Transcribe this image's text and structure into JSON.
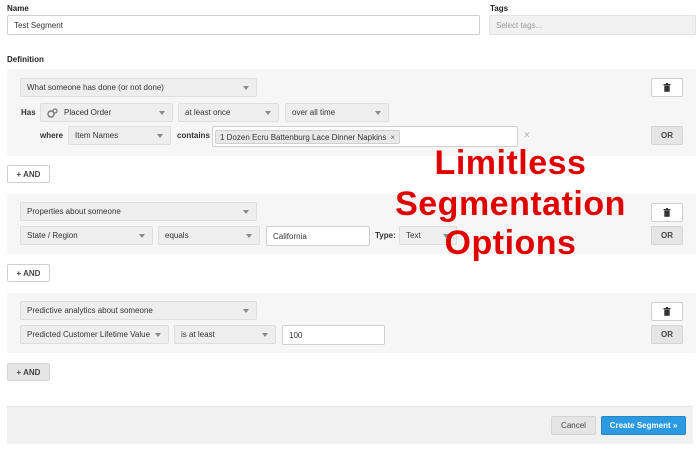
{
  "form": {
    "name_label": "Name",
    "name_value": "Test Segment",
    "tags_label": "Tags",
    "tags_placeholder": "Select tags...",
    "definition_label": "Definition"
  },
  "condition1": {
    "type_select": "What someone has done (or not done)",
    "has_label": "Has",
    "event_select": "Placed Order",
    "frequency_select": "at least once",
    "time_select": "over all time",
    "where_label": "where",
    "property_select": "Item Names",
    "contains_label": "contains",
    "tag_value": "1 Dozen Ecru Battenburg Lace Dinner Napkins",
    "tag_remove": "×",
    "clear_mark": "×",
    "or_button": "OR"
  },
  "and_buttons": [
    "+ AND",
    "+ AND",
    "+ AND"
  ],
  "condition2": {
    "type_select": "Properties about someone",
    "property_select": "State / Region",
    "operator_select": "equals",
    "value": "California",
    "type_label": "Type:",
    "datatype_select": "Text",
    "or_button": "OR"
  },
  "condition3": {
    "type_select": "Predictive analytics about someone",
    "property_select": "Predicted Customer Lifetime Value",
    "operator_select": "is at least",
    "value": "100",
    "or_button": "OR"
  },
  "overlay": {
    "line1": "Limitless",
    "line2": "Segmentation",
    "line3": "Options",
    "color": "#e00000"
  },
  "footer": {
    "cancel_label": "Cancel",
    "create_label": "Create Segment »"
  },
  "icons": {
    "delete": "trash-icon",
    "event": "gears-icon"
  }
}
